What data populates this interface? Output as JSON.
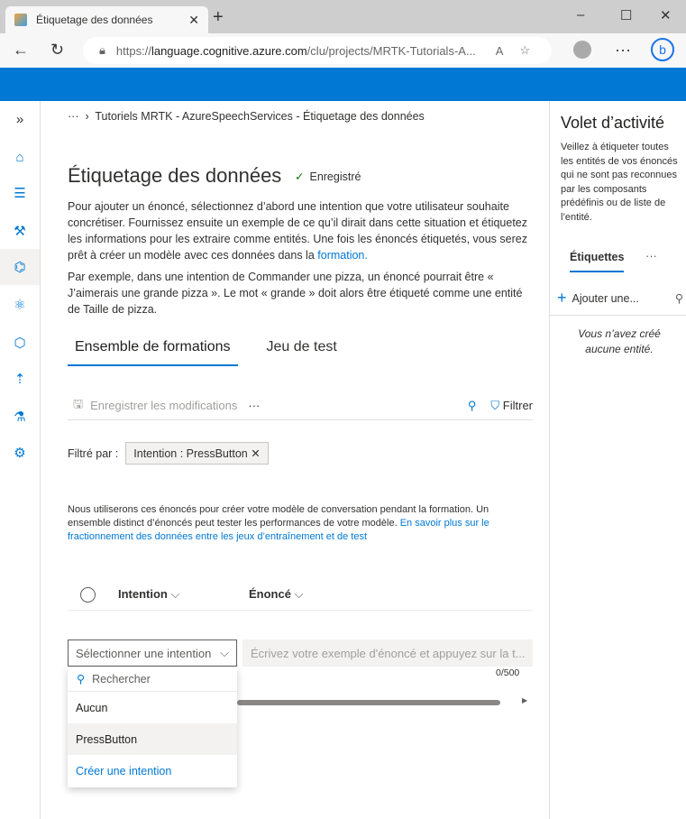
{
  "browser": {
    "tab_title": "Étiquetage des données",
    "url_prefix": "https://",
    "url_host": "language.cognitive.azure.com",
    "url_path": "/clu/projects/MRTK-Tutorials-A..."
  },
  "breadcrumb": {
    "more": "···",
    "path": "Tutoriels MRTK - AzureSpeechServices - Étiquetage des données"
  },
  "page": {
    "title": "Étiquetage des données",
    "status": "Enregistré",
    "desc1": "Pour ajouter un énoncé, sélectionnez d’abord une intention que votre utilisateur souhaite concrétiser. Fournissez ensuite un exemple de ce qu’il dirait dans cette situation et étiquetez les informations pour les extraire comme entités. Une fois les énoncés étiquetés, vous serez prêt à créer un modèle avec ces données dans la ",
    "desc1_link": "formation.",
    "desc2": "Par exemple, dans une intention de Commander une pizza, un énoncé pourrait être « J’aimerais une grande pizza ». Le mot « grande » doit alors être étiqueté comme une entité de Taille de pizza."
  },
  "tabs": [
    "Ensemble de formations",
    "Jeu de test"
  ],
  "toolbar": {
    "save": "Enregistrer les modifications",
    "more": "···",
    "filter": "Filtrer"
  },
  "filter": {
    "label": "Filtré par :",
    "chip": "Intention : PressButton"
  },
  "info": {
    "text": "Nous utiliserons ces énoncés pour créer votre modèle de conversation pendant la formation. Un ensemble distinct d’énoncés peut tester les performances de votre modèle. ",
    "link": "En savoir plus sur le fractionnement des données entre les jeux d’entraînement et de test"
  },
  "table": {
    "col_intent": "Intention",
    "col_utterance": "Énoncé"
  },
  "input": {
    "intent_placeholder": "Sélectionner une intention",
    "utterance_placeholder": "Écrivez votre exemple d'énoncé et appuyez sur la t...",
    "count": "0/500"
  },
  "dropdown": {
    "search": "Rechercher",
    "options": [
      "Aucun",
      "PressButton"
    ],
    "create": "Créer une intention"
  },
  "activity": {
    "title": "Volet d’activité",
    "desc": "Veillez à étiqueter toutes les entités de vos énoncés qui ne sont pas reconnues par les composants prédéfinis ou de liste de l’entité.",
    "tab": "Étiquettes",
    "more": "···",
    "add": "Ajouter une...",
    "empty": "Vous n’avez créé aucune entité."
  }
}
